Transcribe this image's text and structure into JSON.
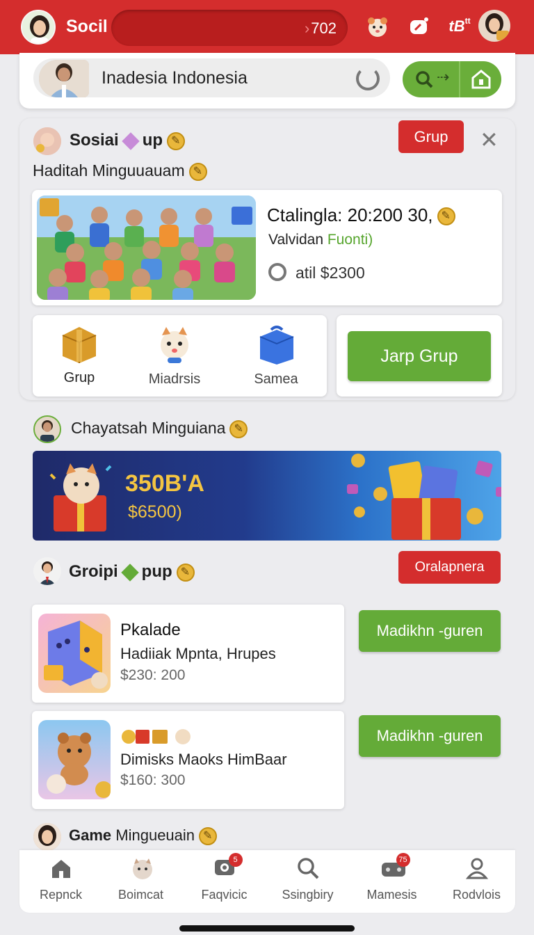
{
  "header": {
    "app_title": "Socil",
    "counter": "702",
    "icons": [
      "profile-avatar-icon",
      "hamster-icon",
      "link-icon",
      "hashtag-icon",
      "user-avatar-icon"
    ]
  },
  "search": {
    "text": "Inadesia Indonesia"
  },
  "group_section": {
    "title_left": "Sosiai",
    "title_right": "up",
    "subtitle": "Haditah Minguuauam",
    "grup_button": "Grup",
    "feature": {
      "title": "Ctalingla: 20:200 30,",
      "sub_prefix": "Valvidan",
      "sub_highlight": "Fuonti)",
      "price": "atil $2300"
    },
    "categories": [
      {
        "label": "Grup"
      },
      {
        "label": "Miadrsis"
      },
      {
        "label": "Samea"
      }
    ],
    "join_button": "Jarp Grup"
  },
  "weekly_section": {
    "title": "Chayatsah Minguiana",
    "banner_amount": "350B'A",
    "banner_sub": "$6500)"
  },
  "groups_list": {
    "title_left": "Groipi",
    "title_right": "pup",
    "action_button": "Oralapnera",
    "items": [
      {
        "name": "Pkalade",
        "desc": "Hadiiak Mpnta, Hrupes",
        "price": "$230: 200",
        "button": "Madikhn -guren"
      },
      {
        "name": "",
        "desc": "Dimisks Maoks HimBaar",
        "price": "$160: 300",
        "button": "Madikhn -guren"
      }
    ]
  },
  "game_section": {
    "title_bold": "Game",
    "title_rest": "Mingueuain"
  },
  "bottom_nav": [
    {
      "label": "Repnck",
      "icon": "home-icon"
    },
    {
      "label": "Boimcat",
      "icon": "pet-icon"
    },
    {
      "label": "Faqvicic",
      "icon": "chat-icon",
      "badge": "5"
    },
    {
      "label": "Ssingbiry",
      "icon": "search-icon"
    },
    {
      "label": "Mamesis",
      "icon": "game-icon",
      "badge": "75"
    },
    {
      "label": "Rodvlois",
      "icon": "profile-icon"
    }
  ]
}
